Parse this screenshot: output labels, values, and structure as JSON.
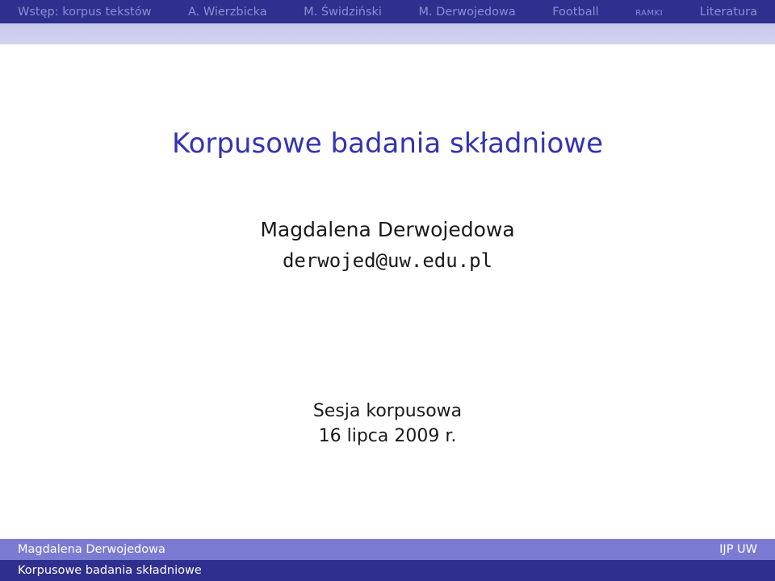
{
  "nav": {
    "items": [
      {
        "label": "Wstęp: korpus tekstów",
        "smallcaps": false
      },
      {
        "label": "A. Wierzbicka",
        "smallcaps": false
      },
      {
        "label": "M. Świdziński",
        "smallcaps": false
      },
      {
        "label": "M. Derwojedowa",
        "smallcaps": false
      },
      {
        "label": "Football",
        "smallcaps": false
      },
      {
        "label": "ramki",
        "smallcaps": true
      },
      {
        "label": "Literatura",
        "smallcaps": false
      }
    ]
  },
  "slide": {
    "title": "Korpusowe badania składniowe",
    "author": "Magdalena Derwojedowa",
    "email": "derwojed@uw.edu.pl",
    "event": "Sesja korpusowa",
    "date": "16 lipca 2009 r."
  },
  "footer": {
    "author": "Magdalena Derwojedowa",
    "institution": "IJP UW",
    "short_title": "Korpusowe badania składniowe"
  },
  "colors": {
    "nav_bg": "#2f2f8f",
    "nav_text": "#8d8dd6",
    "title": "#3333b3",
    "footer_light": "#7b7bd4"
  }
}
